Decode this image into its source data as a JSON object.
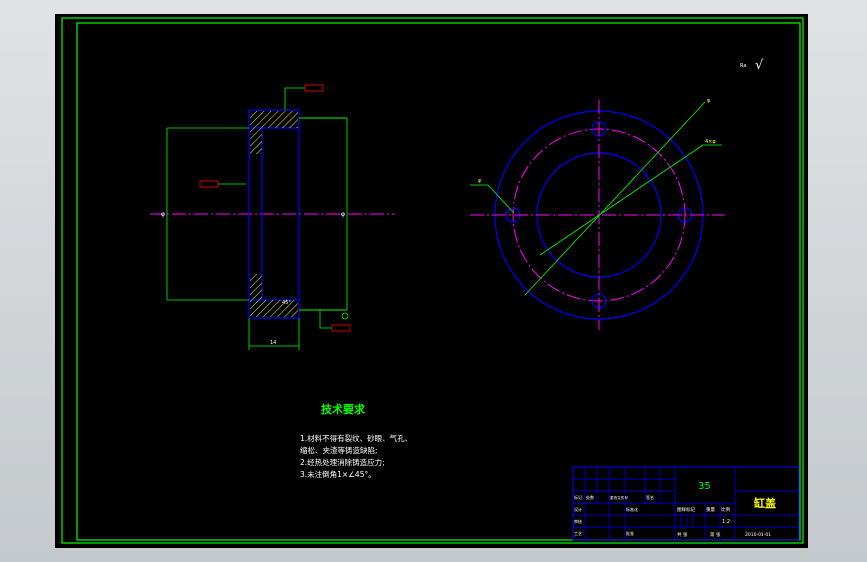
{
  "colors": {
    "background": "#000000",
    "frame": "#00ff00",
    "part": "#0000ff",
    "centerline": "#ff00ff",
    "dimension": "#00ff00",
    "text": "#ffffff",
    "notes_title": "#00ff00",
    "hatch": "#ffff00",
    "tag": "#ff0000"
  },
  "roughness_symbol": "√",
  "roughness_prefix": "Ra",
  "section_view": {
    "dim_left": "φ",
    "dim_right": "φ",
    "dim_width": "14",
    "chamfer": "45°"
  },
  "front_view": {
    "leader_1": "φ",
    "leader_2": "4×φ",
    "leader_3": "φ"
  },
  "notes": {
    "title": "技术要求",
    "lines": [
      "1.材料不得有裂纹、砂眼、气孔、",
      "缩松、夹渣等铸造缺陷;",
      "2.经热处理消除铸造应力;",
      "3.未注倒角1×∠45°。"
    ]
  },
  "title_block": {
    "material": "35",
    "part_name": "缸盖",
    "scale": "1:2",
    "drawing_label": "图样标记",
    "weight_label": "重量",
    "scale_label": "比例",
    "sheet_label": "共 张",
    "sheet_of_label": "第 张",
    "designer_label": "设计",
    "checker_label": "审核",
    "process_label": "工艺",
    "date": "2010-01-01",
    "mark_label": "标记",
    "count_label": "处数",
    "change_label": "更改文件号",
    "sign_label": "签名",
    "std_label": "标准化",
    "approve_label": "批准"
  }
}
